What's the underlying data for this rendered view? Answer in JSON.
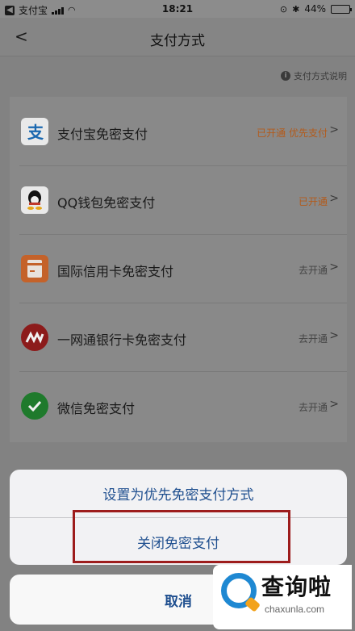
{
  "status_bar": {
    "carrier": "支付宝",
    "time": "18:21",
    "battery": "44%",
    "battery_level": 0.44
  },
  "header": {
    "title": "支付方式",
    "help_text": "支付方式说明"
  },
  "methods": [
    {
      "label": "支付宝免密支付",
      "status": "已开通 优先支付",
      "status_color": "#b35a1a",
      "icon": "alipay-icon"
    },
    {
      "label": "QQ钱包免密支付",
      "status": "已开通",
      "status_color": "#b35a1a",
      "icon": "qq-wallet-icon"
    },
    {
      "label": "国际信用卡免密支付",
      "status": "去开通",
      "status_color": "#444444",
      "icon": "credit-card-icon"
    },
    {
      "label": "一网通银行卡免密支付",
      "status": "去开通",
      "status_color": "#444444",
      "icon": "cmb-bank-icon"
    },
    {
      "label": "微信免密支付",
      "status": "去开通",
      "status_color": "#444444",
      "icon": "wechat-icon"
    }
  ],
  "action_sheet": {
    "set_priority": "设置为优先免密支付方式",
    "close_password_free": "关闭免密支付",
    "cancel": "取消"
  },
  "watermark": {
    "text": "查询啦",
    "url": "chaxunla.com"
  }
}
